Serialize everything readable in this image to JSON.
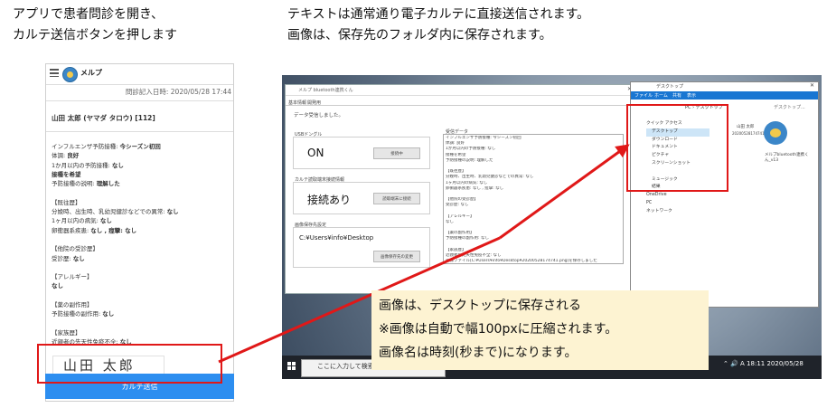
{
  "captions": {
    "left_line1": "アプリで患者問診を開き、",
    "left_line2": "カルテ送信ボタンを押します",
    "right_line1": "テキストは通常通り電子カルテに直接送信されます。",
    "right_line2": "画像は、保存先のフォルダ内に保存されます。"
  },
  "phone": {
    "app_name": "メルプ",
    "datetime": "問診記入日時: 2020/05/28 17:44",
    "patient_name": "山田 太郎 (ヤマダ タロウ) [112]",
    "lines": [
      {
        "t": "インフルエンザ予防接種: ",
        "b": "今シーズン初回"
      },
      {
        "t": "体調: ",
        "b": "良好"
      },
      {
        "t": "1か月以内の予防接種: ",
        "b": "なし"
      },
      {
        "t": "",
        "b": "接種を希望"
      },
      {
        "t": "予防接種の説明: ",
        "b": "理解した"
      },
      {
        "t": "",
        "b": ""
      },
      {
        "t": "【既往歴】",
        "b": ""
      },
      {
        "t": "分娩時、出生時、乳幼児健診などでの異常: ",
        "b": "なし"
      },
      {
        "t": "1ヶ月以内の病気: ",
        "b": "なし"
      },
      {
        "t": "卵衝器系疾患: ",
        "b": "なし , 痙攣: なし"
      },
      {
        "t": "",
        "b": ""
      },
      {
        "t": "【他院の受診歴】",
        "b": ""
      },
      {
        "t": "受診歴: ",
        "b": "なし"
      },
      {
        "t": "",
        "b": ""
      },
      {
        "t": "【アレルギー】",
        "b": ""
      },
      {
        "t": "",
        "b": "なし"
      },
      {
        "t": "",
        "b": ""
      },
      {
        "t": "【薬の副作用】",
        "b": ""
      },
      {
        "t": "予防接種の副作用: ",
        "b": "なし"
      },
      {
        "t": "",
        "b": ""
      },
      {
        "t": "【家族歴】",
        "b": ""
      },
      {
        "t": "近親者の先天性免疫不全: ",
        "b": "なし"
      }
    ],
    "signature": "山田 太郎",
    "send_button": "カルテ送信"
  },
  "bt_app": {
    "title": "メルプ bluetooth連携くん",
    "tabs": [
      "基本情報",
      "開発用"
    ],
    "status": "データ受信しました。",
    "usb_label": "USBドングル",
    "usb_value": "ON",
    "usb_button": "接続中",
    "karte_label": "カルテ読取端末接続情報",
    "karte_value": "接続あり",
    "karte_button": "読取端末に接続",
    "image_label": "画像保存先設定",
    "image_path": "C:¥Users¥info¥Desktop",
    "image_button": "画像保存先の変更",
    "recv_label": "受信データ",
    "recv_lines": [
      "インフルエンザ予防接種: 今シーズン初回",
      "体調: 良好",
      "1か月以内の予防接種: なし",
      "接種を希望",
      "予防接種の説明: 理解した",
      "",
      "【既往歴】",
      "分娩時、出生時、乳幼児健診などでの異常: なし",
      "1ヶ月以内の病気: なし",
      "卵衝器系疾患: なし , 痙攣: なし",
      "",
      "【他院の受診歴】",
      "受診歴: なし",
      "",
      "【アレルギー】",
      "なし",
      "",
      "【薬の副作用】",
      "予防接種の副作用: なし",
      "",
      "【家族歴】",
      "近親者の先天性免疫不全: なし",
      "画像ファイル[C:¥Users¥info¥Desktop¥20200528174741.png]を保存しました"
    ]
  },
  "explorer": {
    "title": "デスクトップ",
    "tabs": [
      "ファイル",
      "ホーム",
      "共有",
      "表示"
    ],
    "path": "PC › デスクトップ",
    "search_placeholder": "デスクトップ...",
    "sidebar": [
      "クイック アクセス",
      "デスクトップ",
      "ダウンロード",
      "ドキュメント",
      "ピクチャ",
      "スクリーンショット",
      "",
      "ミュージック",
      "結果",
      "OneDrive",
      "PC",
      "ネットワーク"
    ],
    "file1_name": "山田 太郎",
    "file1_sub": "20200528174741",
    "file2_name": "メルプbluetooth連携くん_v13"
  },
  "taskbar": {
    "search": "ここに入力して検索",
    "time": "18:11",
    "date": "2020/05/28"
  },
  "callout": {
    "line1": "画像は、デスクトップに保存される",
    "line2": "※画像は自動で幅100pxに圧縮されます。",
    "line3": "画像名は時刻(秒まで)になります。"
  },
  "colors": {
    "highlight_red": "#e01818",
    "send_button_blue": "#2d8ef0",
    "callout_bg": "#fdf3d2"
  }
}
